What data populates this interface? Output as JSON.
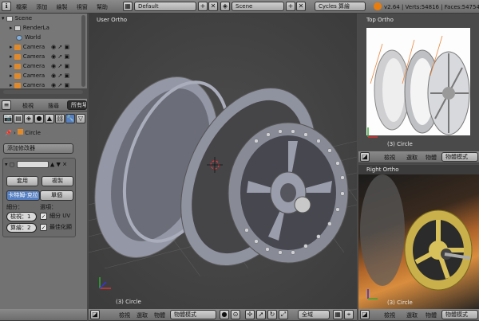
{
  "topbar": {
    "menu": [
      "檔案",
      "添加",
      "繪製",
      "視窗",
      "幫助"
    ],
    "layout": "Default",
    "scene": "Scene",
    "engine": "Cycles 算繪",
    "stats": "v2.64 | Verts:54816 | Faces:54754 |"
  },
  "outliner": {
    "items": [
      {
        "label": "Scene"
      },
      {
        "label": "RenderLa"
      },
      {
        "label": "World"
      },
      {
        "label": "Camera"
      },
      {
        "label": "Camera"
      },
      {
        "label": "Camera"
      },
      {
        "label": "Camera"
      },
      {
        "label": "Camera"
      }
    ],
    "header": {
      "view": "檢視",
      "search": "搜尋",
      "filter": "所有場"
    }
  },
  "properties": {
    "object_name": "Circle",
    "add_modifier": "添加修改器",
    "apply": "套用",
    "copy": "複製",
    "mode_left": "卡特姆-克拉",
    "mode_right": "單個",
    "subdiv_label": "細分：",
    "options_label": "選項：",
    "view_field": "檢視：1",
    "render_field": "算繪：2",
    "subdiv_uv": "細分 UV",
    "optimal": "最佳化顯"
  },
  "viewports": {
    "main": {
      "label": "User Ortho",
      "object": "(3) Circle"
    },
    "top": {
      "label": "Top Ortho",
      "object": "(3) Circle"
    },
    "right": {
      "label": "Right Ortho",
      "object": "(3) Circle"
    }
  },
  "headers": {
    "view": "檢視",
    "select": "選取",
    "object": "物體",
    "object_mode": "物體模式",
    "global": "全域"
  },
  "colors": {
    "accent": "#5680c2",
    "selected_orange": "#f0a030"
  }
}
